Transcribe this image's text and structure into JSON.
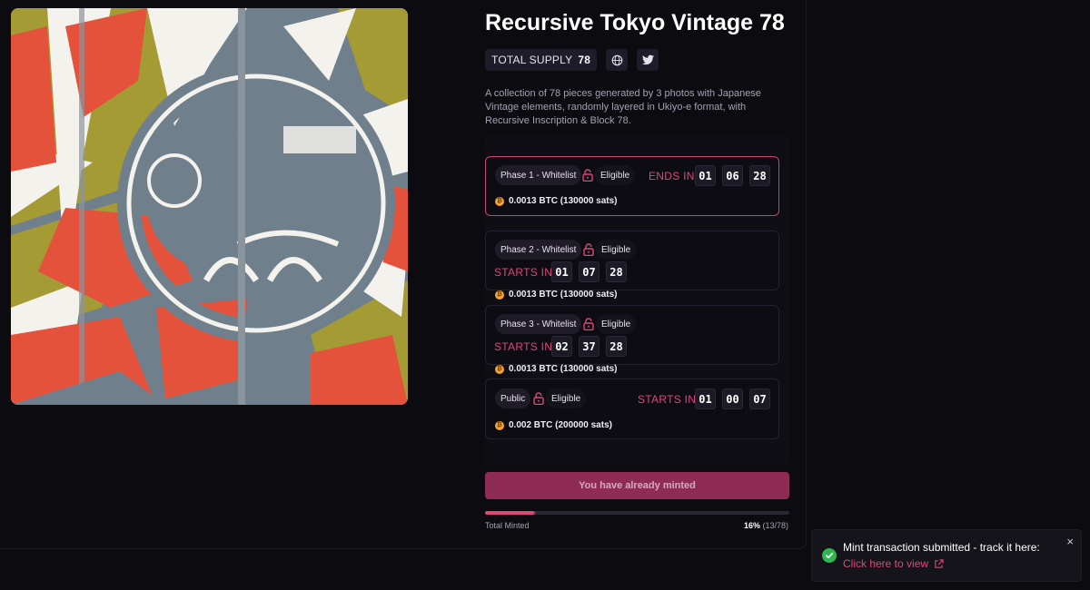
{
  "collection": {
    "title": "Recursive Tokyo Vintage 78",
    "supply_label": "TOTAL SUPPLY",
    "supply_value": "78",
    "description": "A collection of 78 pieces generated by 3 photos with Japanese Vintage elements, randomly layered in Ukiyo-e format, with Recursive Inscription & Block 78.",
    "icons": [
      "globe-icon",
      "twitter-icon"
    ]
  },
  "phases": [
    {
      "name": "Phase 1 - Whitelist",
      "eligibility": "Eligible",
      "timer_label": "ENDS IN",
      "timer": [
        "01",
        "06",
        "28"
      ],
      "price": "0.0013 BTC (130000 sats)",
      "active": true
    },
    {
      "name": "Phase 2 - Whitelist",
      "eligibility": "Eligible",
      "timer_label": "STARTS IN",
      "timer": [
        "01",
        "07",
        "28"
      ],
      "price": "0.0013 BTC (130000 sats)",
      "active": false
    },
    {
      "name": "Phase 3 - Whitelist",
      "eligibility": "Eligible",
      "timer_label": "STARTS IN",
      "timer": [
        "02",
        "37",
        "28"
      ],
      "price": "0.0013 BTC (130000 sats)",
      "active": false
    },
    {
      "name": "Public",
      "eligibility": "Eligible",
      "timer_label": "STARTS IN",
      "timer": [
        "01",
        "00",
        "07"
      ],
      "price": "0.002 BTC (200000 sats)",
      "active": false
    }
  ],
  "mint": {
    "button_label": "You have already minted",
    "progress_label": "Total Minted",
    "progress_percent": "16%",
    "progress_count": "(13/78)",
    "progress_fraction": 0.16
  },
  "toast": {
    "message": "Mint transaction submitted - track it here:",
    "link_label": "Click here to view",
    "close_label": "×"
  },
  "colors": {
    "accent": "#e0467a",
    "button": "#8f2c55",
    "success": "#2fb551",
    "bitcoin": "#f2a33a"
  }
}
